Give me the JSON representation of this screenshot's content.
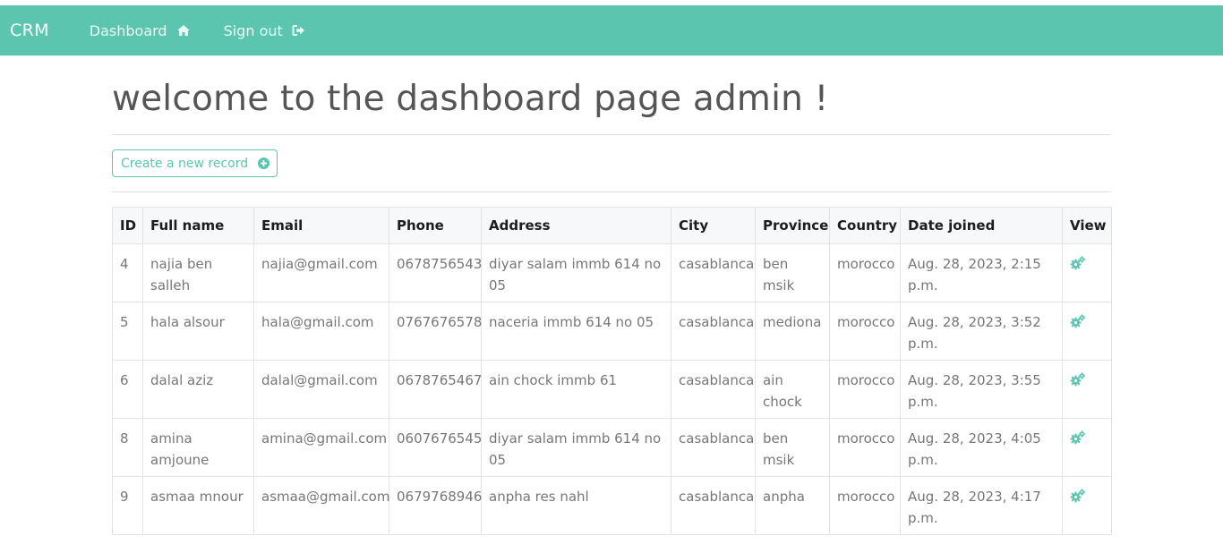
{
  "navbar": {
    "brand": "CRM",
    "dashboard_label": "Dashboard",
    "signout_label": "Sign out",
    "background": "#5bc5b0"
  },
  "page": {
    "title": "welcome to the dashboard page admin !",
    "create_button_label": "Create a new record"
  },
  "table": {
    "headers": [
      "ID",
      "Full name",
      "Email",
      "Phone",
      "Address",
      "City",
      "Province",
      "Country",
      "Date joined",
      "View"
    ],
    "rows": [
      {
        "id": "4",
        "full_name": "najia ben salleh",
        "email": "najia@gmail.com",
        "phone": "0678756543",
        "address": "diyar salam immb 614 no 05",
        "city": "casablanca",
        "province": "ben msik",
        "country": "morocco",
        "date_joined": "Aug. 28, 2023, 2:15 p.m."
      },
      {
        "id": "5",
        "full_name": "hala alsour",
        "email": "hala@gmail.com",
        "phone": "0767676578",
        "address": "naceria immb 614 no 05",
        "city": "casablanca",
        "province": "mediona",
        "country": "morocco",
        "date_joined": "Aug. 28, 2023, 3:52 p.m."
      },
      {
        "id": "6",
        "full_name": "dalal aziz",
        "email": "dalal@gmail.com",
        "phone": "0678765467",
        "address": "ain chock immb 61",
        "city": "casablanca",
        "province": "ain chock",
        "country": "morocco",
        "date_joined": "Aug. 28, 2023, 3:55 p.m."
      },
      {
        "id": "8",
        "full_name": "amina amjoune",
        "email": "amina@gmail.com",
        "phone": "0607676545",
        "address": "diyar salam immb 614 no 05",
        "city": "casablanca",
        "province": "ben msik",
        "country": "morocco",
        "date_joined": "Aug. 28, 2023, 4:05 p.m."
      },
      {
        "id": "9",
        "full_name": "asmaa mnour",
        "email": "asmaa@gmail.com",
        "phone": "0679768946",
        "address": "anpha res nahl",
        "city": "casablanca",
        "province": "anpha",
        "country": "morocco",
        "date_joined": "Aug. 28, 2023, 4:17 p.m."
      }
    ],
    "view_icon": "gears-icon"
  },
  "colors": {
    "accent": "#5bc5b0",
    "title_text": "#555555",
    "cell_text": "#777777"
  }
}
